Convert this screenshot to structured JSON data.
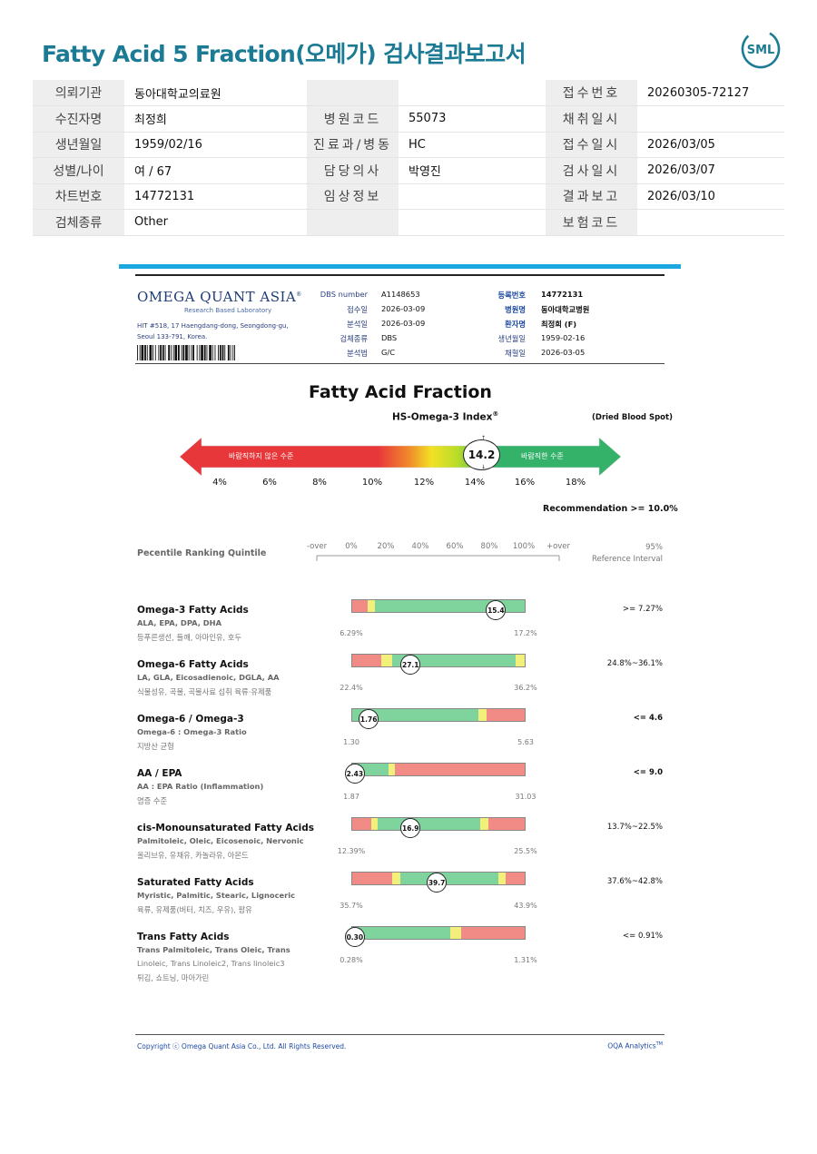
{
  "report": {
    "title": "Fatty Acid 5 Fraction(오메가) 검사결과보고서",
    "logo_text": "SML"
  },
  "patient_info": [
    {
      "l1": "의뢰기관",
      "v1": "동아대학교의료원",
      "l2": "",
      "v2": "",
      "l3": "접수번호",
      "v3": "20260305-72127"
    },
    {
      "l1": "수진자명",
      "v1": "최정희",
      "l2": "병원코드",
      "v2": "55073",
      "l3": "채취일시",
      "v3": ""
    },
    {
      "l1": "생년월일",
      "v1": "1959/02/16",
      "l2": "진료과/병동",
      "v2": "HC",
      "l3": "접수일시",
      "v3": "2026/03/05"
    },
    {
      "l1": "성별/나이",
      "v1": "여 / 67",
      "l2": "담당의사",
      "v2": "박영진",
      "l3": "검사일시",
      "v3": "2026/03/07"
    },
    {
      "l1": "차트번호",
      "v1": "14772131",
      "l2": "임상정보",
      "v2": "",
      "l3": "결과보고",
      "v3": "2026/03/10"
    },
    {
      "l1": "검체종류",
      "v1": "Other",
      "l2": "",
      "v2": "",
      "l3": "보험코드",
      "v3": ""
    }
  ],
  "lab": {
    "name": "OMEGA QUANT ASIA",
    "tm": "®",
    "subtitle": "Research Based Laboratory",
    "address_line1": "HIT #518, 17 Haengdang-dong, Seongdong-gu,",
    "address_line2": "Seoul 133-791, Korea."
  },
  "sample_info": {
    "left": [
      {
        "label": "DBS number",
        "value": "A1148653"
      },
      {
        "label": "접수일",
        "value": "2026-03-09"
      },
      {
        "label": "분석일",
        "value": "2026-03-09"
      },
      {
        "label": "검체종류",
        "value": "DBS"
      },
      {
        "label": "분석법",
        "value": "G/C"
      }
    ],
    "right": [
      {
        "label": "등록번호",
        "value": "14772131",
        "bold": true
      },
      {
        "label": "병원명",
        "value": "동아대학교병원",
        "bold": true
      },
      {
        "label": "환자명",
        "value": "최정희 (F)",
        "bold": true
      },
      {
        "label": "생년월일",
        "value": "1959-02-16",
        "bold": false
      },
      {
        "label": "채혈일",
        "value": "2026-03-05",
        "bold": false
      }
    ]
  },
  "index": {
    "section_title": "Fatty Acid Fraction",
    "name": "HS-Omega-3 Index",
    "reg": "®",
    "sample_type": "(Dried Blood Spot)",
    "bad_label": "바람직하지 않은 수준",
    "good_label": "바람직한 수준",
    "score": "14.2",
    "score_value": 14.2,
    "scale": [
      "4%",
      "6%",
      "8%",
      "10%",
      "12%",
      "14%",
      "16%",
      "18%"
    ],
    "recommendation": "Recommendation  >= 10.0%",
    "colors": {
      "bad": "#e8373b",
      "good": "#35b26a",
      "mid": "#c8e023"
    }
  },
  "percentile_header": {
    "label": "Pecentile Ranking Quintile",
    "axis": [
      "-over",
      "0%",
      "20%",
      "40%",
      "60%",
      "80%",
      "100%",
      "+over"
    ],
    "ref_line1": "95%",
    "ref_line2": "Reference Interval"
  },
  "fatty_acids": [
    {
      "name": "Omega-3 Fatty Acids",
      "sub": "ALA, EPA, DPA, DHA",
      "kr": "등푸른생선, 들깨, 아마인유, 호두",
      "kr2": "",
      "value": "15.4",
      "low": "6.29%",
      "high": "17.2%",
      "ref": ">= 7.27%",
      "ref_bold": false,
      "segments": [
        {
          "c": "r",
          "w": 0.09
        },
        {
          "c": "y",
          "w": 0.04
        },
        {
          "c": "g",
          "w": 0.87
        }
      ],
      "marker_pos": 0.83
    },
    {
      "name": "Omega-6 Fatty Acids",
      "sub": "LA, GLA, Eicosadienoic, DGLA, AA",
      "kr": "식물성유, 곡물, 곡물사료 섭취 육류·유제품",
      "kr2": "",
      "value": "27.1",
      "low": "22.4%",
      "high": "36.2%",
      "ref": "24.8%~36.1%",
      "ref_bold": false,
      "segments": [
        {
          "c": "r",
          "w": 0.17
        },
        {
          "c": "y",
          "w": 0.06
        },
        {
          "c": "g",
          "w": 0.72
        },
        {
          "c": "y",
          "w": 0.05
        }
      ],
      "marker_pos": 0.34
    },
    {
      "name": "Omega-6 / Omega-3",
      "sub": "Omega-6 : Omega-3 Ratio",
      "kr": "지방산 균형",
      "kr2": "",
      "value": "1.76",
      "low": "1.30",
      "high": "5.63",
      "ref": "<= 4.6",
      "ref_bold": true,
      "segments": [
        {
          "c": "g",
          "w": 0.73
        },
        {
          "c": "y",
          "w": 0.05
        },
        {
          "c": "r",
          "w": 0.22
        }
      ],
      "marker_pos": 0.1
    },
    {
      "name": "AA / EPA",
      "sub": "AA : EPA Ratio (Inflammation)",
      "kr": "염증 수준",
      "kr2": "",
      "value": "2.43",
      "low": "1.87",
      "high": "31.03",
      "ref": "<= 9.0",
      "ref_bold": true,
      "segments": [
        {
          "c": "g",
          "w": 0.21
        },
        {
          "c": "y",
          "w": 0.04
        },
        {
          "c": "r",
          "w": 0.75
        }
      ],
      "marker_pos": 0.02
    },
    {
      "name": "cis-Monounsaturated Fatty Acids",
      "sub": "Palmitoleic, Oleic, Eicosenoic, Nervonic",
      "kr": "올리브유, 유채유, 카놀라유, 아몬드",
      "kr2": "",
      "value": "16.9",
      "low": "12.39%",
      "high": "25.5%",
      "ref": "13.7%~22.5%",
      "ref_bold": false,
      "segments": [
        {
          "c": "r",
          "w": 0.11
        },
        {
          "c": "y",
          "w": 0.04
        },
        {
          "c": "g",
          "w": 0.59
        },
        {
          "c": "y",
          "w": 0.05
        },
        {
          "c": "r",
          "w": 0.21
        }
      ],
      "marker_pos": 0.34
    },
    {
      "name": "Saturated Fatty Acids",
      "sub": "Myristic, Palmitic, Stearic, Lignoceric",
      "kr": "육류, 유제품(버터, 치즈, 우유), 팜유",
      "kr2": "",
      "value": "39.7",
      "low": "35.7%",
      "high": "43.9%",
      "ref": "37.6%~42.8%",
      "ref_bold": false,
      "segments": [
        {
          "c": "r",
          "w": 0.23
        },
        {
          "c": "y",
          "w": 0.05
        },
        {
          "c": "g",
          "w": 0.57
        },
        {
          "c": "y",
          "w": 0.04
        },
        {
          "c": "r",
          "w": 0.11
        }
      ],
      "marker_pos": 0.49
    },
    {
      "name": "Trans Fatty Acids",
      "sub": "Trans Palmitoleic, Trans Oleic, Trans",
      "kr": "Linoleic, Trans Linoleic2, Trans linoleic3",
      "kr2": "튀김, 쇼트닝, 마아가린",
      "value": "0.30",
      "low": "0.28%",
      "high": "1.31%",
      "ref": "<= 0.91%",
      "ref_bold": false,
      "segments": [
        {
          "c": "g",
          "w": 0.57
        },
        {
          "c": "y",
          "w": 0.06
        },
        {
          "c": "r",
          "w": 0.37
        }
      ],
      "marker_pos": 0.02
    }
  ],
  "footer": {
    "copyright": "Copyright ⓒ Omega Quant Asia Co., Ltd.  All Rights Reserved.",
    "analytics": "OQA Analytics",
    "tm": "TM"
  },
  "colors": {
    "title": "#1b7b94",
    "accent_blue": "#1ba7df",
    "bar_red": "#f08b86",
    "bar_yellow": "#f2f07a",
    "bar_green": "#7fd39c"
  }
}
